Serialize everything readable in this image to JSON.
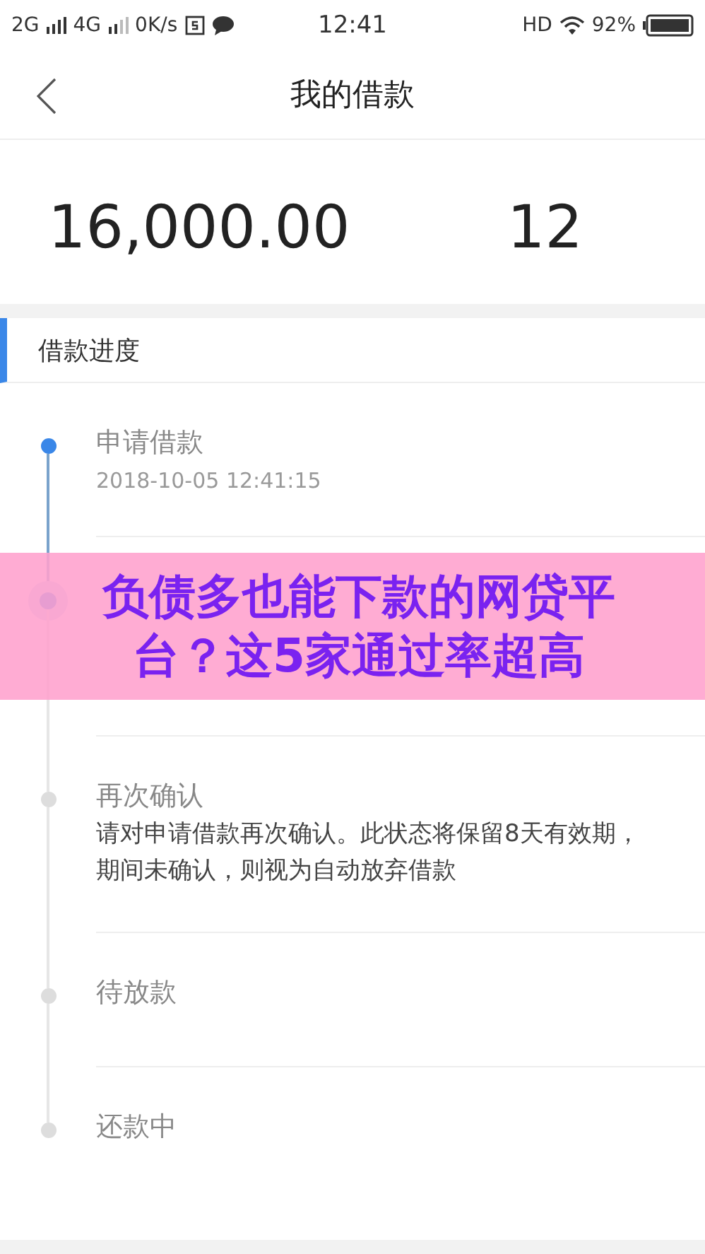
{
  "status_bar": {
    "network_1": "2G",
    "network_2": "4G",
    "speed": "0K/s",
    "time": "12:41",
    "hd": "HD",
    "battery": "92%"
  },
  "nav": {
    "title": "我的借款"
  },
  "summary": {
    "amount": "16,000.00",
    "periods": "12"
  },
  "progress": {
    "title": "借款进度",
    "steps": [
      {
        "title": "申请借款",
        "date": "2018-10-05 12:41:15",
        "completed": true,
        "current": false
      },
      {
        "completed": false,
        "current": true
      },
      {
        "title": "再次确认",
        "description": "请对申请借款再次确认。此状态将保留8天有效期，期间未确认，则视为自动放弃借款",
        "completed": false,
        "current": false
      },
      {
        "title": "待放款",
        "completed": false,
        "current": false
      },
      {
        "title": "还款中",
        "completed": false,
        "current": false
      }
    ]
  },
  "banner": {
    "headline": "负债多也能下款的网贷平台？这5家通过率超高"
  }
}
